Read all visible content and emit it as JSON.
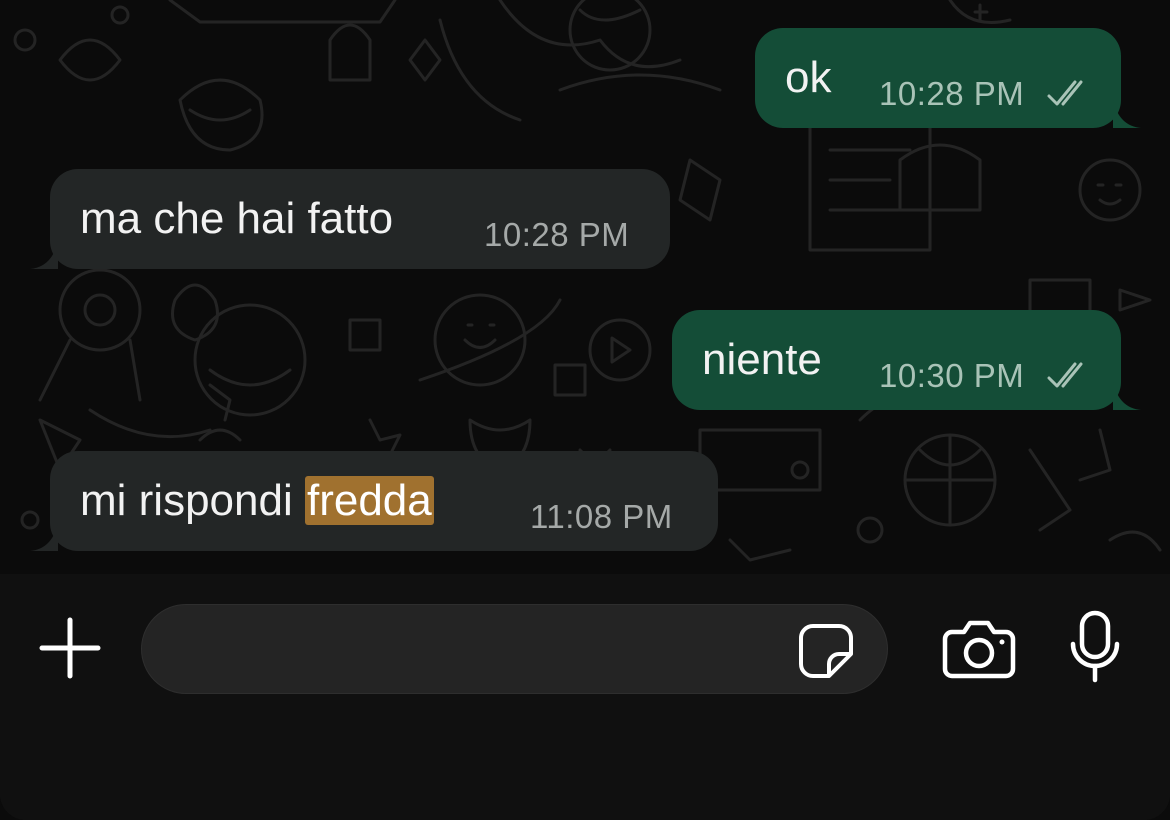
{
  "chat": {
    "messages": [
      {
        "direction": "outgoing",
        "text": "ok",
        "time": "10:28 PM",
        "status": "read"
      },
      {
        "direction": "incoming",
        "text": "ma che hai fatto",
        "time": "10:28 PM"
      },
      {
        "direction": "outgoing",
        "text": "niente",
        "time": "10:30 PM",
        "status": "read"
      },
      {
        "direction": "incoming",
        "text_before": "mi rispondi ",
        "text_highlight": "fredda",
        "time": "11:08 PM"
      }
    ]
  },
  "composer": {
    "message_value": "",
    "icons": [
      "plus-icon",
      "sticker-icon",
      "camera-icon",
      "microphone-icon"
    ]
  },
  "colors": {
    "outgoing_bubble": "#144d37",
    "incoming_bubble": "#232626",
    "background": "#0b0b0b",
    "search_highlight": "#a0712f"
  }
}
